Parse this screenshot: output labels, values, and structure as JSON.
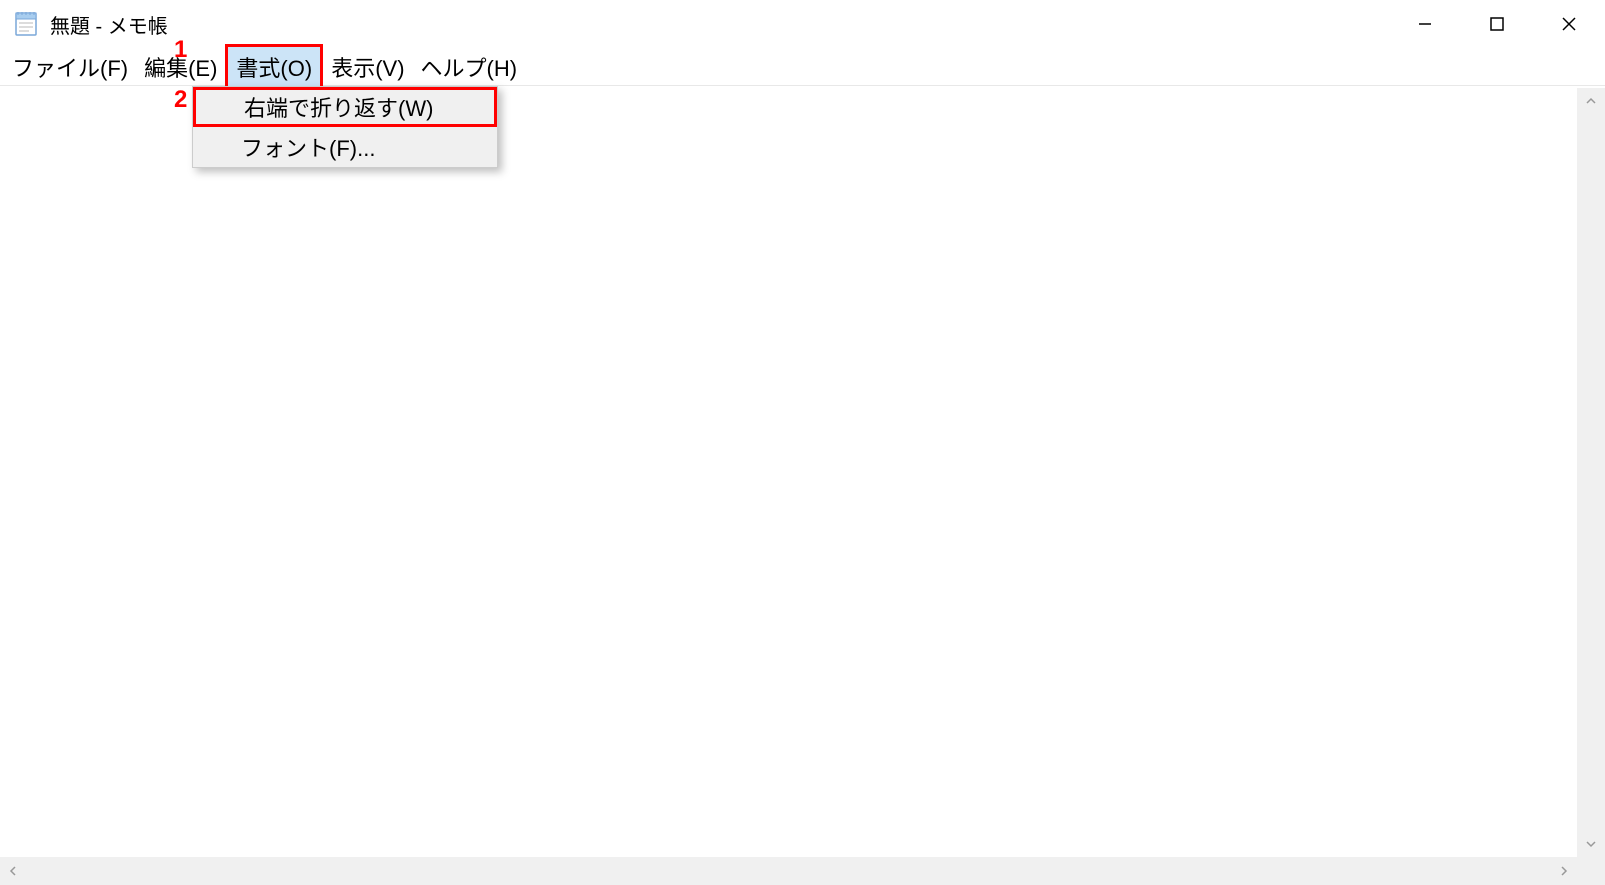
{
  "title": "無題 - メモ帳",
  "menu": {
    "file": "ファイル(F)",
    "edit": "編集(E)",
    "format": "書式(O)",
    "view": "表示(V)",
    "help": "ヘルプ(H)"
  },
  "dropdown": {
    "wrap": "右端で折り返す(W)",
    "font": "フォント(F)..."
  },
  "annotations": {
    "one": "1",
    "two": "2"
  }
}
